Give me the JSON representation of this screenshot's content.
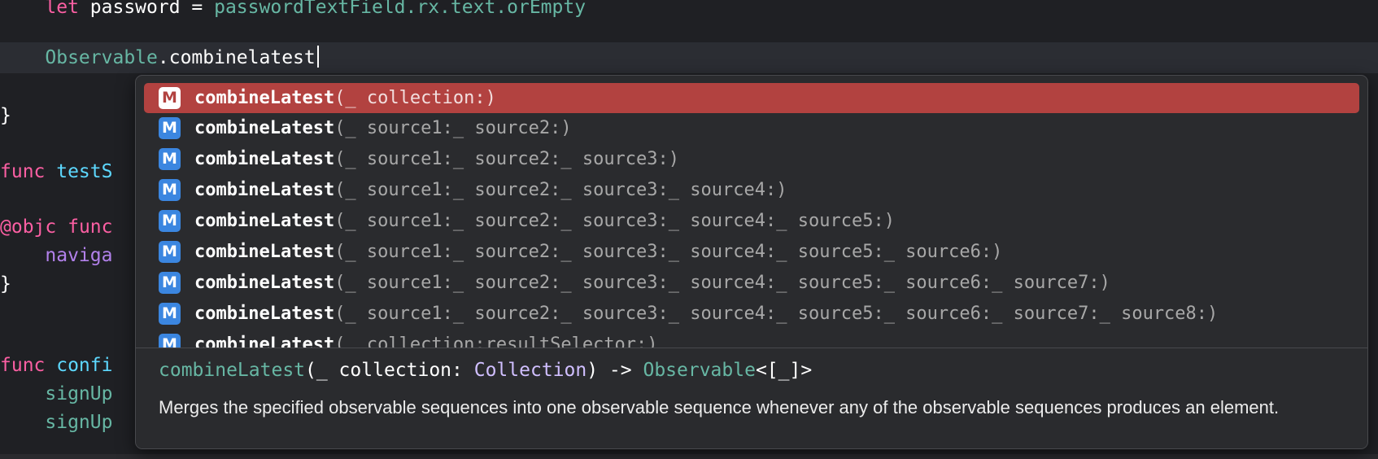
{
  "editor": {
    "lines": {
      "password_let": "let",
      "password_rest": " password = ",
      "password_expr": "passwordTextField.rx.text.orEmpty",
      "observable_type": "Observable",
      "observable_method": ".combinelatest",
      "close_brace_1": "}",
      "func_test_kw": "func",
      "func_test_name": " testS",
      "objc_attr": "@objc",
      "objc_func": " func",
      "navig": "naviga",
      "close_brace_2": "}",
      "func_config_kw": "func",
      "func_config_name": " confi",
      "signup_1": "signUp",
      "signup_2": "signUp"
    }
  },
  "autocomplete": {
    "badge": "M",
    "items": [
      {
        "name": "combineLatest",
        "params": "(_ collection:)"
      },
      {
        "name": "combineLatest",
        "params": "(_ source1:_ source2:)"
      },
      {
        "name": "combineLatest",
        "params": "(_ source1:_ source2:_ source3:)"
      },
      {
        "name": "combineLatest",
        "params": "(_ source1:_ source2:_ source3:_ source4:)"
      },
      {
        "name": "combineLatest",
        "params": "(_ source1:_ source2:_ source3:_ source4:_ source5:)"
      },
      {
        "name": "combineLatest",
        "params": "(_ source1:_ source2:_ source3:_ source4:_ source5:_ source6:)"
      },
      {
        "name": "combineLatest",
        "params": "(_ source1:_ source2:_ source3:_ source4:_ source5:_ source6:_ source7:)"
      },
      {
        "name": "combineLatest",
        "params": "(_ source1:_ source2:_ source3:_ source4:_ source5:_ source6:_ source7:_ source8:)"
      },
      {
        "name": "combineLatest",
        "params": "(_ collection:resultSelector:)"
      }
    ],
    "detail": {
      "sig_name": "combineLatest",
      "sig_open": "(_ collection: ",
      "sig_type": "Collection",
      "sig_mid": ") -> ",
      "sig_ret": "Observable",
      "sig_tail": "<[_]>",
      "description": "Merges the specified observable sequences into one observable sequence whenever any of the observable sequences produces an element."
    }
  },
  "colors": {
    "selection": "#b24240",
    "method_badge": "#3b86e0",
    "keyword": "#fc5fa3",
    "identifier": "#67b7a4"
  }
}
